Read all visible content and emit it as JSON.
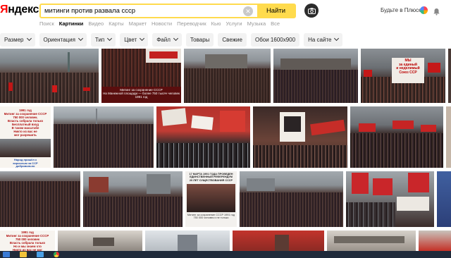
{
  "header": {
    "logo_ya": "Я",
    "logo_rest": "ндекс",
    "search_value": "митинги против развала ссср",
    "search_button": "Найти",
    "plus_label": "Будьте в Плюсе",
    "clear_icon": "close-icon",
    "camera_icon": "camera-icon"
  },
  "nav": [
    {
      "label": "Поиск",
      "active": false
    },
    {
      "label": "Картинки",
      "active": true
    },
    {
      "label": "Видео",
      "active": false
    },
    {
      "label": "Карты",
      "active": false
    },
    {
      "label": "Маркет",
      "active": false
    },
    {
      "label": "Новости",
      "active": false
    },
    {
      "label": "Переводчик",
      "active": false
    },
    {
      "label": "Кью",
      "active": false
    },
    {
      "label": "Услуги",
      "active": false
    },
    {
      "label": "Музыка",
      "active": false
    },
    {
      "label": "Все",
      "active": false
    }
  ],
  "filters": [
    {
      "label": "Размер",
      "dropdown": true
    },
    {
      "label": "Ориентация",
      "dropdown": true
    },
    {
      "label": "Тип",
      "dropdown": true
    },
    {
      "label": "Цвет",
      "dropdown": true
    },
    {
      "label": "Файл",
      "dropdown": true
    },
    {
      "label": "Товары",
      "dropdown": false
    },
    {
      "label": "Свежие",
      "dropdown": false
    },
    {
      "label": "Обои 1600х900",
      "dropdown": false
    },
    {
      "label": "На сайте",
      "dropdown": true
    }
  ],
  "image_captions": {
    "tile2": "Митинг за сохранение СССР\nНа Манежной площади — более 750 тысяч человек\n1991 год",
    "tile6": "1991 год\nМитинг за сохранение СССР\n750 000 человек.\nВласть собрала только\nБесплатный вход\nВ таком масштабе\nНикто из вас не\nмог разрешить",
    "tile6b": "Народ пришёл к\nвзрослым за ССР\nдобровольно",
    "tile10": "17 МАРТА 1991 ГОДА ПРОВЕДЕН\nЕДИНСТВЕННЫЙ РЕФЕРЕНДУМ\n20 ЛЕТ СУЩЕСТВОВАНИЯ СССР",
    "tile10b": "Митинг за сохранение СССР 1991 год\n750 000 человек и не только",
    "tile_bottom1": "1991 год\nМитинг за сохранение СССР\n750 000 человек\nВласть собрала только\nНо и мы знаем что\nНикто из вас не мог",
    "banner": "МЫ\nза единый\nи неделимый\nСоюз ССР"
  },
  "colors": {
    "accent": "#ffdb4d",
    "logo_red": "#ff0000",
    "taskbar": "#1f2a3a"
  }
}
